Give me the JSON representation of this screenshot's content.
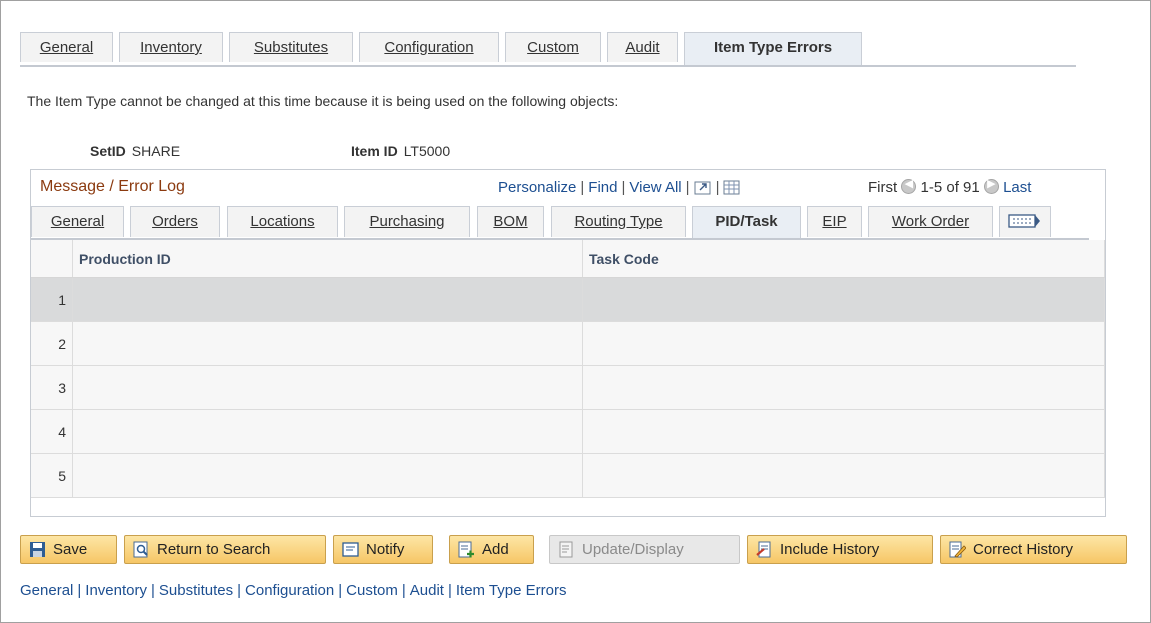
{
  "top_tabs": [
    "General",
    "Inventory",
    "Substitutes",
    "Configuration",
    "Custom",
    "Audit",
    "Item Type Errors"
  ],
  "message": "The Item Type cannot be changed at this time because it is being used on the following objects:",
  "setid": {
    "label": "SetID",
    "value": "SHARE"
  },
  "item_id": {
    "label": "Item ID",
    "value": "LT5000"
  },
  "grid": {
    "title": "Message / Error Log",
    "personalize": "Personalize",
    "find": "Find",
    "view_all": "View All",
    "first": "First",
    "range": "1-5 of 91",
    "last": "Last",
    "sub_tabs": [
      "General",
      "Orders",
      "Locations",
      "Purchasing",
      "BOM",
      "Routing Type",
      "PID/Task",
      "EIP",
      "Work Order"
    ],
    "columns": [
      "Production ID",
      "Task Code"
    ],
    "rows": [
      "1",
      "2",
      "3",
      "4",
      "5"
    ]
  },
  "buttons": {
    "save": "Save",
    "return_to_search": "Return to Search",
    "notify": "Notify",
    "add": "Add",
    "update_display": "Update/Display",
    "include_history": "Include History",
    "correct_history": "Correct History"
  },
  "footer_links": [
    "General",
    "Inventory",
    "Substitutes",
    "Configuration",
    "Custom",
    "Audit",
    "Item Type Errors"
  ]
}
